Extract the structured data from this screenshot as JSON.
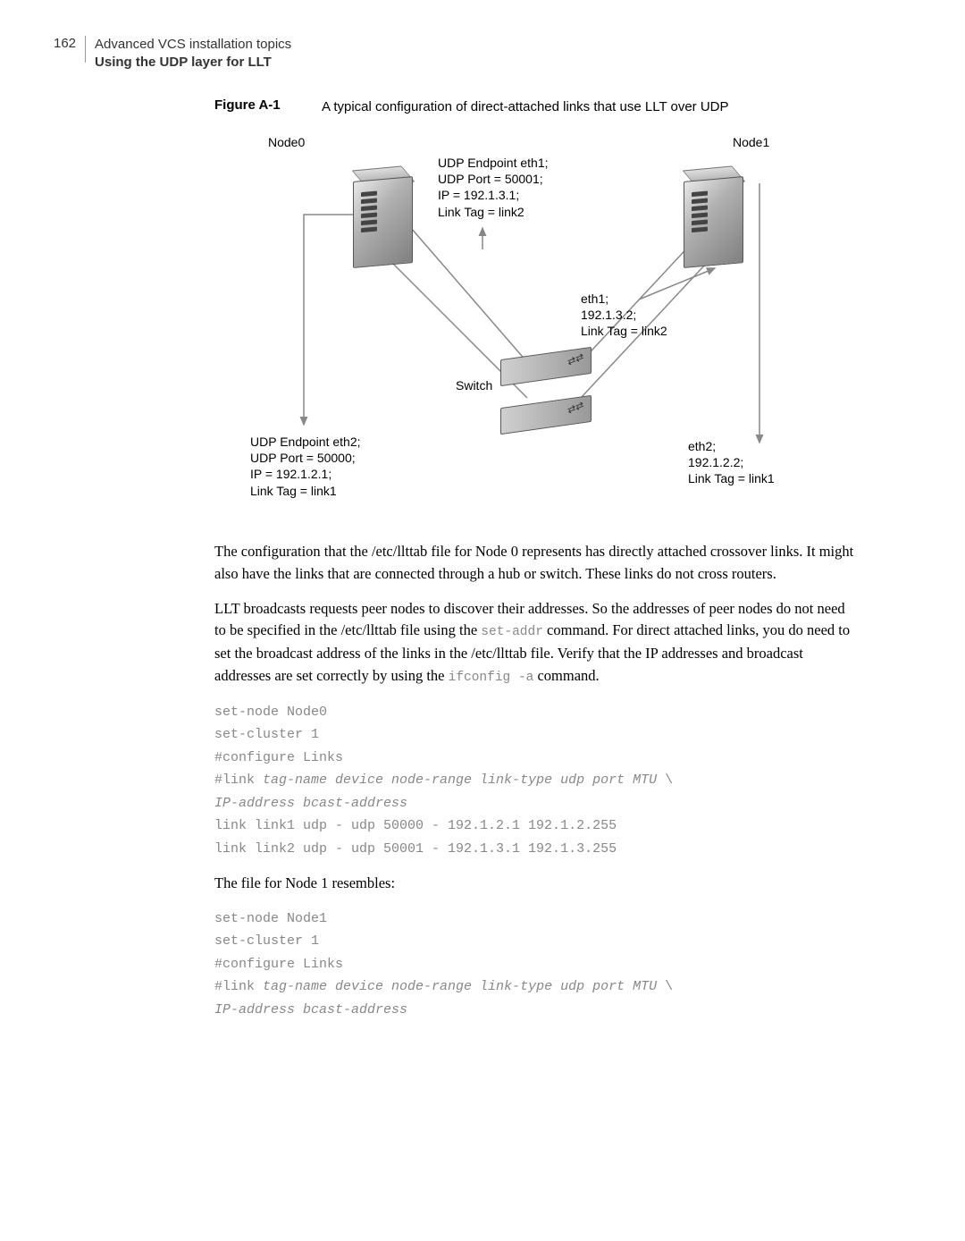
{
  "header": {
    "pageNum": "162",
    "title": "Advanced VCS installation topics",
    "subtitle": "Using the UDP layer for LLT"
  },
  "figure": {
    "label": "Figure A-1",
    "caption": "A typical configuration of direct-attached links that use LLT over UDP"
  },
  "diagram": {
    "node0": "Node0",
    "node1": "Node1",
    "endpoint1_l1": "UDP Endpoint eth1;",
    "endpoint1_l2": "UDP Port = 50001;",
    "endpoint1_l3": "IP = 192.1.3.1;",
    "endpoint1_l4": "Link Tag = link2",
    "eth1_l1": "eth1;",
    "eth1_l2": "192.1.3.2;",
    "eth1_l3": "Link Tag = link2",
    "switch": "Switch",
    "endpoint2_l1": "UDP Endpoint eth2;",
    "endpoint2_l2": "UDP Port = 50000;",
    "endpoint2_l3": "IP = 192.1.2.1;",
    "endpoint2_l4": "Link Tag = link1",
    "eth2_l1": "eth2;",
    "eth2_l2": "192.1.2.2;",
    "eth2_l3": "Link Tag = link1"
  },
  "para1": "The configuration that the /etc/llttab file for Node 0 represents has directly attached crossover links. It might also have the links that are connected through a hub or switch. These links do not cross routers.",
  "para2_a": "LLT broadcasts requests peer nodes to discover their addresses. So the addresses of peer nodes do not need to be specified in the /etc/llttab file using the ",
  "para2_code1": "set-addr",
  "para2_b": " command. For direct attached links, you do need to set the broadcast address of the links in the /etc/llttab file. Verify that the IP addresses and broadcast addresses are set correctly by using the ",
  "para2_code2": "ifconfig -a",
  "para2_c": " command.",
  "code1": {
    "l1": "set-node Node0",
    "l2": "set-cluster 1",
    "l3": "#configure Links",
    "l4a": "#link ",
    "l4b": "tag-name device node-range link-type udp port MTU",
    "l4c": " \\",
    "l5": "IP-address bcast-address",
    "l6": "link link1 udp - udp 50000 - 192.1.2.1 192.1.2.255",
    "l7": "link link2 udp - udp 50001 - 192.1.3.1 192.1.3.255"
  },
  "para3": "The file for Node 1 resembles:",
  "code2": {
    "l1": "set-node Node1",
    "l2": "set-cluster 1",
    "l3": "#configure Links",
    "l4a": "#link ",
    "l4b": "tag-name device node-range link-type udp port MTU",
    "l4c": " \\",
    "l5": "IP-address bcast-address"
  }
}
